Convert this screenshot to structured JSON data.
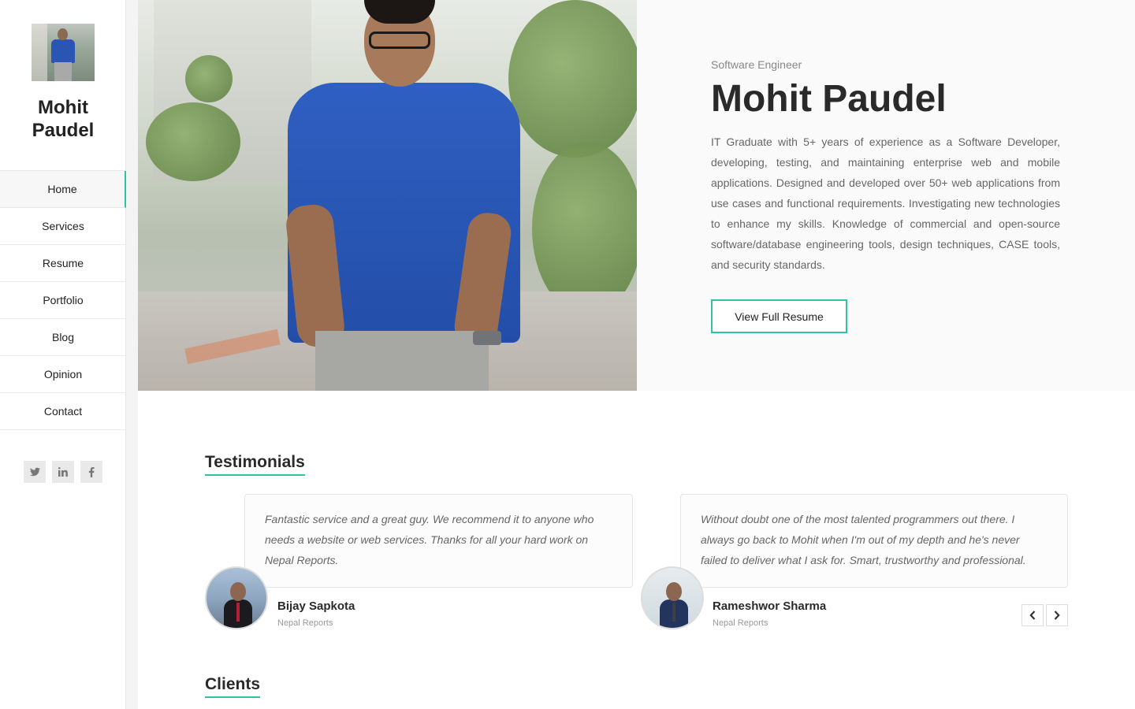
{
  "profile": {
    "name": "Mohit Paudel",
    "name_line1": "Mohit",
    "name_line2": "Paudel"
  },
  "nav": {
    "items": [
      {
        "label": "Home",
        "active": true
      },
      {
        "label": "Services"
      },
      {
        "label": "Resume"
      },
      {
        "label": "Portfolio"
      },
      {
        "label": "Blog"
      },
      {
        "label": "Opinion"
      },
      {
        "label": "Contact"
      }
    ]
  },
  "socials": [
    "twitter-icon",
    "linkedin-icon",
    "facebook-icon"
  ],
  "hero": {
    "role": "Software Engineer",
    "name": "Mohit Paudel",
    "description": "IT Graduate with 5+ years of experience as a Software Developer, developing, testing, and maintaining enterprise web and mobile applications. Designed and developed over 50+ web applications from use cases and functional requirements. Investigating new technologies to enhance my skills. Knowledge of commercial and open-source software/database engineering tools, design techniques, CASE tools, and security standards.",
    "button_label": "View Full Resume"
  },
  "testimonials": {
    "title": "Testimonials",
    "items": [
      {
        "quote": "Fantastic service and a great guy. We recommend it to anyone who needs a website or web services. Thanks for all your hard work on Nepal Reports.",
        "name": "Bijay Sapkota",
        "org": "Nepal Reports"
      },
      {
        "quote": "Without doubt one of the most talented programmers out there. I always go back to Mohit when I'm out of my depth and he's never failed to deliver what I ask for. Smart, trustworthy and professional.",
        "name": "Rameshwor Sharma",
        "org": "Nepal Reports"
      }
    ]
  },
  "clients": {
    "title": "Clients"
  },
  "colors": {
    "accent": "#2ec4a0",
    "text": "#2a2a2a",
    "muted": "#666666"
  }
}
